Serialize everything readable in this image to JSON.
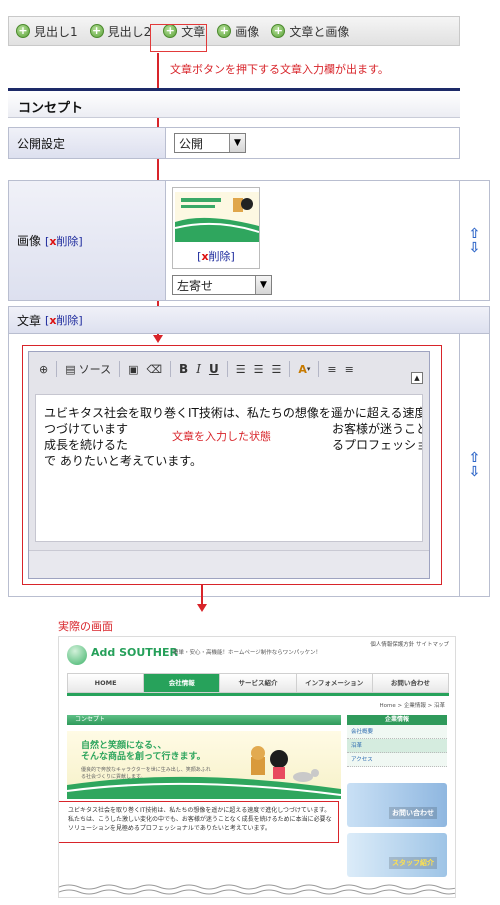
{
  "toolbar": {
    "buttons": [
      {
        "label": "見出し1",
        "icon": "plus-circle-icon"
      },
      {
        "label": "見出し2",
        "icon": "plus-circle-icon"
      },
      {
        "label": "文章",
        "icon": "plus-circle-icon"
      },
      {
        "label": "画像",
        "icon": "plus-circle-icon"
      },
      {
        "label": "文章と画像",
        "icon": "plus-circle-icon"
      }
    ]
  },
  "annotations": {
    "toolbar_note": "文章ボタンを押下する文章入力欄が出ます。",
    "editor_note": "文章を入力した状態",
    "preview_caption": "実際の画面"
  },
  "section": {
    "title": "コンセプト"
  },
  "publish": {
    "label": "公開設定",
    "value": "公開"
  },
  "image_row": {
    "label": "画像",
    "delete_label": "削除",
    "thumb_delete_label": "削除",
    "align_value": "左寄せ"
  },
  "text_row": {
    "label": "文章",
    "delete_label": "削除"
  },
  "editor": {
    "source_label": "ソース",
    "bold": "B",
    "italic": "I",
    "underline": "U",
    "font_color": "A",
    "collapse": "▲",
    "lines": [
      {
        "left": "ユビキタス社会を取り巻くIT技術は、私たちの想像を遥かに超える速度で進",
        "right": ""
      },
      {
        "left": "つづけています",
        "right": "お客様が迷うこと"
      },
      {
        "left": "成長を続けるた",
        "right": "るプロフェッショ"
      },
      {
        "left": "で ありたいと考えています。",
        "right": ""
      }
    ]
  },
  "preview": {
    "logo": "Add SOUTHER",
    "tagline": "簡単・安心・高機能！ホームページ制作ならワンパッケン！",
    "top_links": "個人情報保護方針  サイトマップ",
    "nav": [
      "HOME",
      "会社情報",
      "サービス紹介",
      "インフォメーション",
      "お問い合わせ"
    ],
    "nav_active": 1,
    "breadcrumb": "Home > 企業情報 > 沿革",
    "content_title": "コンセプト",
    "banner_line1": "自然と笑顔になる、、",
    "banner_line2": "そんな商品を創って行きます。",
    "banner_small": "優良的で奔放なキャラクターを世に生み出し、笑顔あふれる社会づくりに貢献します。",
    "body_text": "ユビキタス社会を取り巻くIT技術は、私たちの想像を遥かに超える速度で進化しつづけています。私たちは、こうした激しい変化の中でも、お客様が迷うことなく成長を続けるために本当に必要なソリューションを見極めるプロフェッショナルでありたいと考えています。",
    "sidebar_title": "企業情報",
    "sidebar_items": [
      "会社概要",
      "沿革",
      "アクセス"
    ],
    "sidebar_active": 1,
    "side_banner1": "お問い合わせ",
    "side_banner2": "スタッフ紹介"
  },
  "colors": {
    "accent_red": "#d8242a",
    "nav_green": "#27a25b",
    "header_navy": "#1d2a68",
    "link_blue": "#1d2a9d"
  }
}
